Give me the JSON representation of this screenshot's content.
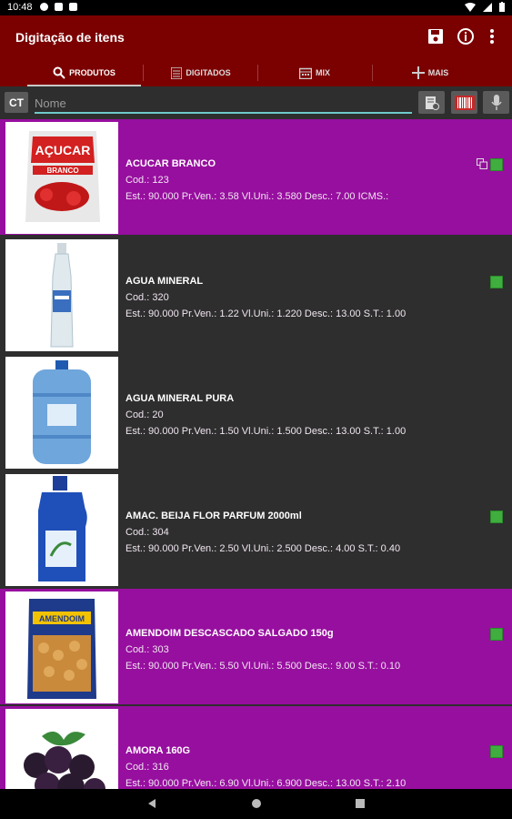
{
  "status": {
    "time": "10:48"
  },
  "appbar": {
    "title": "Digitação de itens"
  },
  "tabs": [
    {
      "label": "PRODUTOS",
      "icon": "search-icon"
    },
    {
      "label": "DIGITADOS",
      "icon": "list-icon"
    },
    {
      "label": "MIX",
      "icon": "calendar-icon"
    },
    {
      "label": "MAIS",
      "icon": "plus-icon"
    }
  ],
  "search": {
    "ct_label": "CT",
    "placeholder": "Nome"
  },
  "products": [
    {
      "name": "ACUCAR BRANCO",
      "code": "Cod.: 123",
      "details": "Est.: 90.000 Pr.Ven.: 3.58 Vl.Uni.: 3.580 Desc.: 7.00 ICMS.:",
      "image_text": "AÇUCAR",
      "image_sub": "BRANCO"
    },
    {
      "name": "AGUA MINERAL",
      "code": "Cod.: 320",
      "details": "Est.: 90.000 Pr.Ven.: 1.22 Vl.Uni.: 1.220 Desc.: 13.00 S.T.: 1.00"
    },
    {
      "name": "AGUA MINERAL PURA",
      "code": "Cod.: 20",
      "details": "Est.: 90.000 Pr.Ven.: 1.50 Vl.Uni.: 1.500 Desc.: 13.00 S.T.: 1.00"
    },
    {
      "name": "AMAC. BEIJA FLOR PARFUM 2000ml",
      "code": "Cod.: 304",
      "details": "Est.: 90.000 Pr.Ven.: 2.50 Vl.Uni.: 2.500 Desc.: 4.00 S.T.: 0.40"
    },
    {
      "name": "AMENDOIM DESCASCADO SALGADO 150g",
      "code": "Cod.: 303",
      "details": "Est.: 90.000 Pr.Ven.: 5.50 Vl.Uni.: 5.500 Desc.: 9.00 S.T.: 0.10",
      "image_text": "AMENDOIM"
    },
    {
      "name": "AMORA 160G",
      "code": "Cod.: 316",
      "details": "Est.: 90.000 Pr.Ven.: 6.90 Vl.Uni.: 6.900 Desc.: 13.00 S.T.: 2.10"
    }
  ],
  "colors": {
    "appbar": "#7b0000",
    "row_purple": "#970f9f",
    "row_dark": "#2e2e2e",
    "accent": "#6ecaca",
    "indicator": "#3fae3f"
  }
}
